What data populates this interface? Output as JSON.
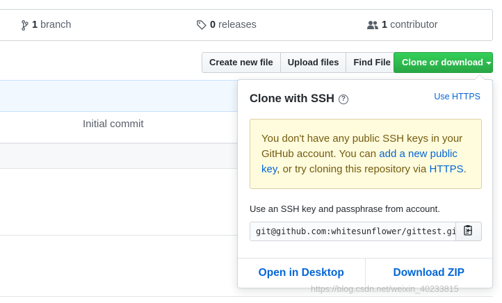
{
  "summary": {
    "branch_count": "1",
    "branch_label": "branch",
    "release_count": "0",
    "release_label": "releases",
    "contributor_count": "1",
    "contributor_label": "contributor"
  },
  "toolbar": {
    "create_label": "Create new file",
    "upload_label": "Upload files",
    "find_label": "Find File",
    "clone_label": "Clone or download"
  },
  "files": {
    "commit_message": "Initial commit"
  },
  "clone": {
    "title": "Clone with SSH",
    "help_icon": "?",
    "use_https": "Use HTTPS",
    "flash_part1": "You don't have any public SSH keys in your GitHub account. You can ",
    "flash_link1": "add a new public key",
    "flash_part2": ", or try cloning this repository via ",
    "flash_link2": "HTTPS",
    "flash_part3": ".",
    "ssh_note": "Use an SSH key and passphrase from account.",
    "url": "git@github.com:whitesunflower/gittest.git",
    "open_desktop": "Open in Desktop",
    "download_zip": "Download ZIP"
  },
  "watermark": "https://blog.csdn.net/weixin_40233815",
  "colors": {
    "accent": "#0366d6",
    "green": "#28a745",
    "flash_bg": "#fffbdd",
    "flash_text": "#735c0f"
  },
  "icons": {
    "branch": "git-branch-icon",
    "tag": "tag-icon",
    "people": "people-icon",
    "clipboard": "clipboard-icon",
    "help": "question-icon"
  }
}
